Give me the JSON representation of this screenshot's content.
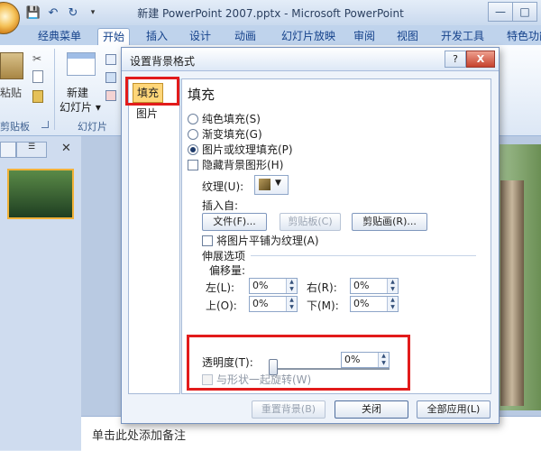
{
  "window": {
    "title": "新建 PowerPoint 2007.pptx - Microsoft PowerPoint",
    "controls": [
      "—",
      "□"
    ]
  },
  "quick_access": {
    "customize_label": "▾"
  },
  "ribbon": {
    "tabs": [
      "经典菜单",
      "开始",
      "插入",
      "设计",
      "动画",
      "幻灯片放映",
      "审阅",
      "视图",
      "开发工具",
      "特色功能"
    ],
    "active_tab": "开始",
    "paste_label": "粘贴",
    "new_slide_label_1": "新建",
    "new_slide_label_2": "幻灯片",
    "new_slide_arrow": "▾",
    "group_clipboard": "剪贴板",
    "group_slides": "幻灯片"
  },
  "notes": {
    "placeholder": "单击此处添加备注"
  },
  "dialog": {
    "title": "设置背景格式",
    "help": "?",
    "close": "X",
    "nav": [
      "填充",
      "图片"
    ],
    "section_title": "填充",
    "fill_options": [
      {
        "label": "纯色填充(S)",
        "selected": false
      },
      {
        "label": "渐变填充(G)",
        "selected": false
      },
      {
        "label": "图片或纹理填充(P)",
        "selected": true
      }
    ],
    "hide_bg_graphics": "隐藏背景图形(H)",
    "texture_label": "纹理(U):",
    "insert_from": "插入自:",
    "file_btn": "文件(F)...",
    "clipboard_btn": "剪贴板(C)",
    "clipart_btn": "剪贴画(R)...",
    "tile_label": "将图片平铺为纹理(A)",
    "stretch_title": "伸展选项",
    "offset_title": "偏移量:",
    "offsets": [
      {
        "label": "左(L):",
        "value": "0%"
      },
      {
        "label": "右(R):",
        "value": "0%"
      },
      {
        "label": "上(O):",
        "value": "0%"
      },
      {
        "label": "下(M):",
        "value": "0%"
      }
    ],
    "transparency_label": "透明度(T):",
    "transparency_value": "0%",
    "transparency_level": 0,
    "rotate_label": "与形状一起旋转(W)",
    "reset_btn": "重置背景(B)",
    "close_btn": "关闭",
    "apply_all_btn": "全部应用(L)"
  },
  "colors": {
    "highlight": "#e21b1b",
    "nav_active": "#ffd679",
    "ribbon_text": "#15428b"
  }
}
